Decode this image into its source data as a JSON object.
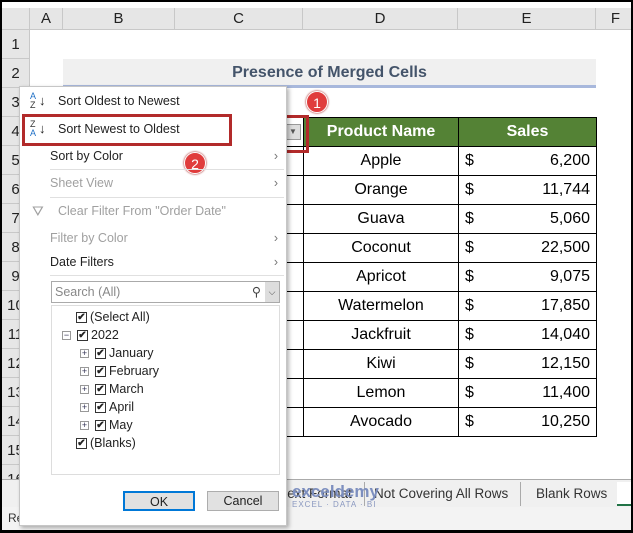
{
  "columns": [
    "A",
    "B",
    "C",
    "D",
    "E",
    "F"
  ],
  "rows": [
    "1",
    "2",
    "3",
    "4",
    "5",
    "6",
    "7",
    "8",
    "9",
    "10",
    "11",
    "12",
    "13",
    "14",
    "15",
    "16"
  ],
  "title": "Presence of Merged Cells",
  "table": {
    "headers": [
      "Product Name",
      "Sales"
    ],
    "rows": [
      [
        "Apple",
        "$",
        "6,200"
      ],
      [
        "Orange",
        "$",
        "11,744"
      ],
      [
        "Guava",
        "$",
        "5,060"
      ],
      [
        "Coconut",
        "$",
        "22,500"
      ],
      [
        "Apricot",
        "$",
        "9,075"
      ],
      [
        "Watermelon",
        "$",
        "17,850"
      ],
      [
        "Jackfruit",
        "$",
        "14,040"
      ],
      [
        "Kiwi",
        "$",
        "12,150"
      ],
      [
        "Lemon",
        "$",
        "11,400"
      ],
      [
        "Avocado",
        "$",
        "10,250"
      ]
    ]
  },
  "badges": [
    "1",
    "2"
  ],
  "menu": {
    "sort_asc": "Sort Oldest to Newest",
    "sort_desc": "Sort Newest to Oldest",
    "sort_color": "Sort by Color",
    "sheet_view": "Sheet View",
    "clear_filter": "Clear Filter From \"Order Date\"",
    "filter_color": "Filter by Color",
    "date_filters": "Date Filters",
    "search_placeholder": "Search (All)",
    "tree": {
      "select_all": "(Select All)",
      "year": "2022",
      "months": [
        "January",
        "February",
        "March",
        "April",
        "May"
      ],
      "blanks": "(Blanks)"
    },
    "ok": "OK",
    "cancel": "Cancel"
  },
  "tabs": [
    "...ext Format",
    "Not Covering All Rows",
    "Blank Rows"
  ],
  "status": "Re",
  "watermark": "exceldemy EXCEL · DATA · BI",
  "colors": {
    "header_green": "#548235",
    "title_text": "#44546a",
    "highlight": "#b22a2a"
  }
}
